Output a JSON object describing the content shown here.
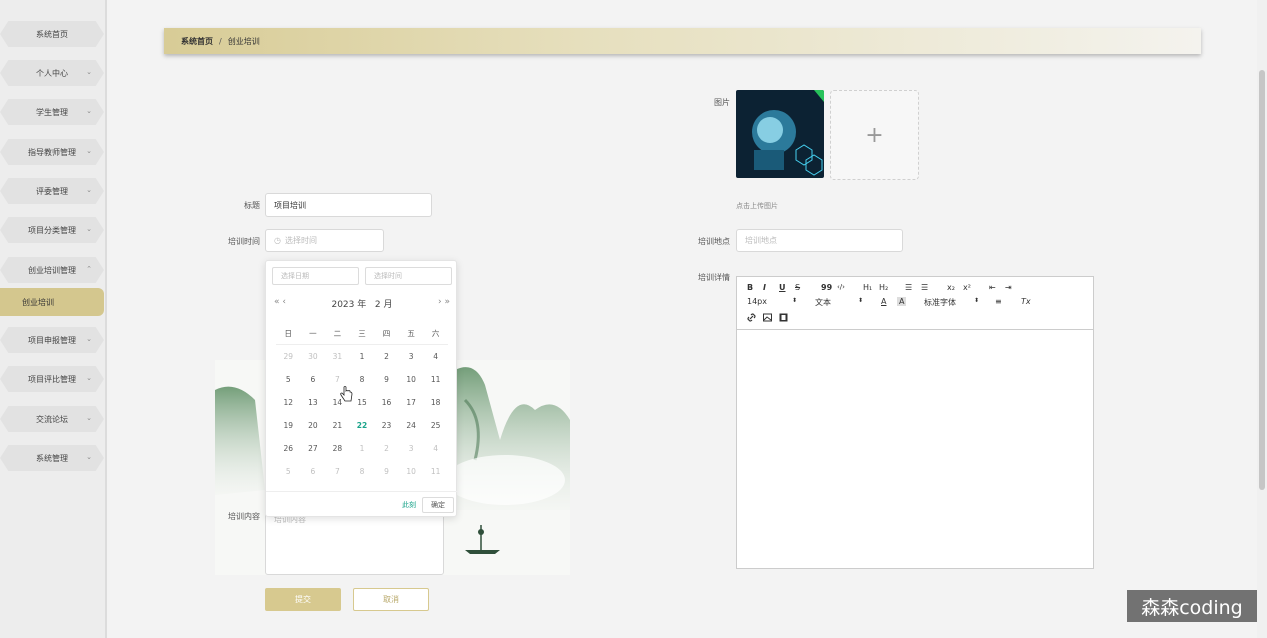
{
  "sidebar": {
    "items": [
      {
        "label": "系统首页",
        "chevron": ""
      },
      {
        "label": "个人中心",
        "chevron": "⌄"
      },
      {
        "label": "学生管理",
        "chevron": "⌄"
      },
      {
        "label": "指导教师管理",
        "chevron": "⌄"
      },
      {
        "label": "评委管理",
        "chevron": "⌄"
      },
      {
        "label": "项目分类管理",
        "chevron": "⌄"
      },
      {
        "label": "创业培训管理",
        "chevron": "⌃"
      },
      {
        "label": "创业培训",
        "chevron": ""
      },
      {
        "label": "项目申报管理",
        "chevron": "⌄"
      },
      {
        "label": "项目评比管理",
        "chevron": "⌄"
      },
      {
        "label": "交流论坛",
        "chevron": "⌄"
      },
      {
        "label": "系统管理",
        "chevron": "⌄"
      }
    ]
  },
  "breadcrumb": {
    "home": "系统首页",
    "separator": "/",
    "current": "创业培训"
  },
  "form": {
    "title_label": "标题",
    "title_value": "项目培训",
    "time_label": "培训时间",
    "time_placeholder": "选择时间",
    "content_label": "培训内容",
    "content_placeholder": "培训内容",
    "image_label": "图片",
    "upload_plus": "+",
    "upload_tip": "点击上传图片",
    "location_label": "培训地点",
    "location_placeholder": "培训地点",
    "detail_label": "培训详情"
  },
  "picker": {
    "date_placeholder": "选择日期",
    "time_placeholder": "选择时间",
    "prev": "« ‹",
    "next": "› »",
    "year": "2023",
    "year_suffix": "年",
    "month": "2",
    "month_suffix": "月",
    "weekdays": [
      "日",
      "一",
      "二",
      "三",
      "四",
      "五",
      "六"
    ],
    "weeks": [
      [
        {
          "d": "29",
          "o": true
        },
        {
          "d": "30",
          "o": true
        },
        {
          "d": "31",
          "o": true
        },
        {
          "d": "1"
        },
        {
          "d": "2"
        },
        {
          "d": "3"
        },
        {
          "d": "4"
        }
      ],
      [
        {
          "d": "5"
        },
        {
          "d": "6"
        },
        {
          "d": "7",
          "o": true
        },
        {
          "d": "8"
        },
        {
          "d": "9"
        },
        {
          "d": "10"
        },
        {
          "d": "11"
        }
      ],
      [
        {
          "d": "12"
        },
        {
          "d": "13"
        },
        {
          "d": "14"
        },
        {
          "d": "15"
        },
        {
          "d": "16"
        },
        {
          "d": "17"
        },
        {
          "d": "18"
        }
      ],
      [
        {
          "d": "19"
        },
        {
          "d": "20"
        },
        {
          "d": "21"
        },
        {
          "d": "22",
          "t": true
        },
        {
          "d": "23"
        },
        {
          "d": "24"
        },
        {
          "d": "25"
        }
      ],
      [
        {
          "d": "26"
        },
        {
          "d": "27"
        },
        {
          "d": "28"
        },
        {
          "d": "1",
          "o": true
        },
        {
          "d": "2",
          "o": true
        },
        {
          "d": "3",
          "o": true
        },
        {
          "d": "4",
          "o": true
        }
      ],
      [
        {
          "d": "5",
          "o": true
        },
        {
          "d": "6",
          "o": true
        },
        {
          "d": "7",
          "o": true
        },
        {
          "d": "8",
          "o": true
        },
        {
          "d": "9",
          "o": true
        },
        {
          "d": "10",
          "o": true
        },
        {
          "d": "11",
          "o": true
        }
      ]
    ],
    "now_label": "此刻",
    "ok_label": "确定"
  },
  "editor": {
    "font_size": "14px",
    "block_type": "文本",
    "font_family": "标准字体",
    "buttons": {
      "bold": "B",
      "italic": "I",
      "underline": "U",
      "strike": "S",
      "quote": "99",
      "code": "‹/›",
      "h1": "H₁",
      "h2": "H₂",
      "ol": "☰",
      "ul": "☰",
      "sub": "x₂",
      "sup": "x²",
      "outdent": "⇤",
      "indent": "⇥",
      "color": "A",
      "bg": "A",
      "align": "≡",
      "clean": "Tx",
      "link": "🔗",
      "image": "▣",
      "video": "▤"
    }
  },
  "buttons": {
    "submit": "提交",
    "cancel": "取消"
  },
  "watermark": "森森coding"
}
